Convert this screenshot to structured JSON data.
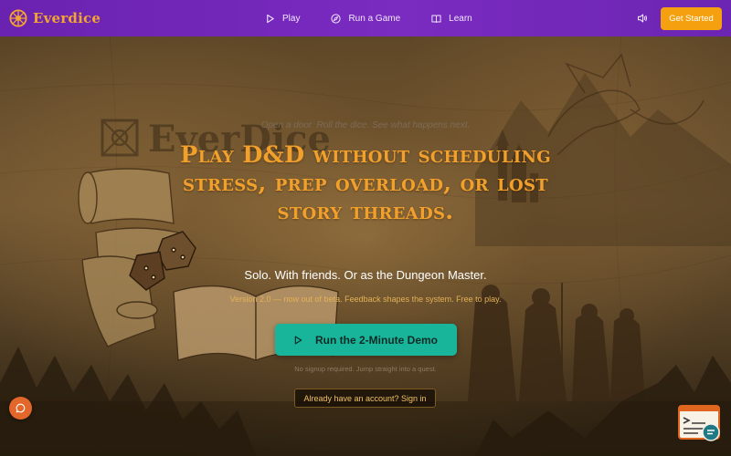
{
  "nav": {
    "brand": "Everdice",
    "links": [
      {
        "label": "Play",
        "icon": "play-icon"
      },
      {
        "label": "Run a Game",
        "icon": "compass-icon"
      },
      {
        "label": "Learn",
        "icon": "book-icon"
      }
    ],
    "sound_icon": "speaker-icon",
    "cta": "Get Started"
  },
  "hero": {
    "tagline": "Open a door. Roll the dice. See what happens next.",
    "headline": "Play D&D without scheduling stress, prep overload, or lost story threads.",
    "subhead": "Solo. With friends. Or as the Dungeon Master.",
    "version_note": "Version 2.0 — now out of beta. Feedback shapes the system. Free to play.",
    "demo_button": "Run the 2-Minute Demo",
    "no_signup": "No signup required. Jump straight into a quest.",
    "signin_button": "Already have an account? Sign in",
    "background_logo": "EverDice"
  },
  "widgets": {
    "chat_icon": "chat-bubble-icon",
    "feedback_icon": "feedback-widget-icon"
  },
  "colors": {
    "nav_purple": "#7a2bc0",
    "accent_orange": "#f5a00f",
    "headline_gold": "#f2a02c",
    "teal_cta": "#18b59a",
    "chat_orange": "#e3662a"
  }
}
